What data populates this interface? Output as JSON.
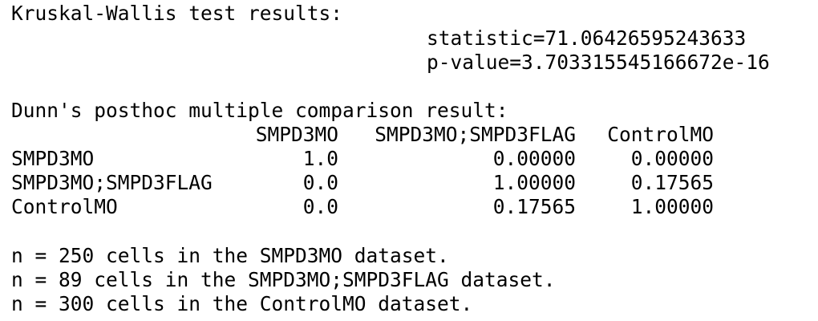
{
  "kruskal": {
    "title": "Kruskal-Wallis test results:",
    "statistic": "statistic=71.06426595243633",
    "pvalue": "p-value=3.703315545166672e-16"
  },
  "dunn": {
    "title": "Dunn's posthoc multiple comparison result:",
    "columns": [
      "SMPD3MO",
      "SMPD3MO;SMPD3FLAG",
      "ControlMO"
    ],
    "rows": [
      {
        "label": "SMPD3MO",
        "values": [
          "1.0",
          "0.00000",
          "0.00000"
        ]
      },
      {
        "label": "SMPD3MO;SMPD3FLAG",
        "values": [
          "0.0",
          "1.00000",
          "0.17565"
        ]
      },
      {
        "label": "ControlMO",
        "values": [
          "0.0",
          "0.17565",
          "1.00000"
        ]
      }
    ]
  },
  "counts": [
    "n = 250 cells in the SMPD3MO dataset.",
    "n = 89 cells in the SMPD3MO;SMPD3FLAG dataset.",
    "n = 300 cells in the ControlMO dataset."
  ]
}
